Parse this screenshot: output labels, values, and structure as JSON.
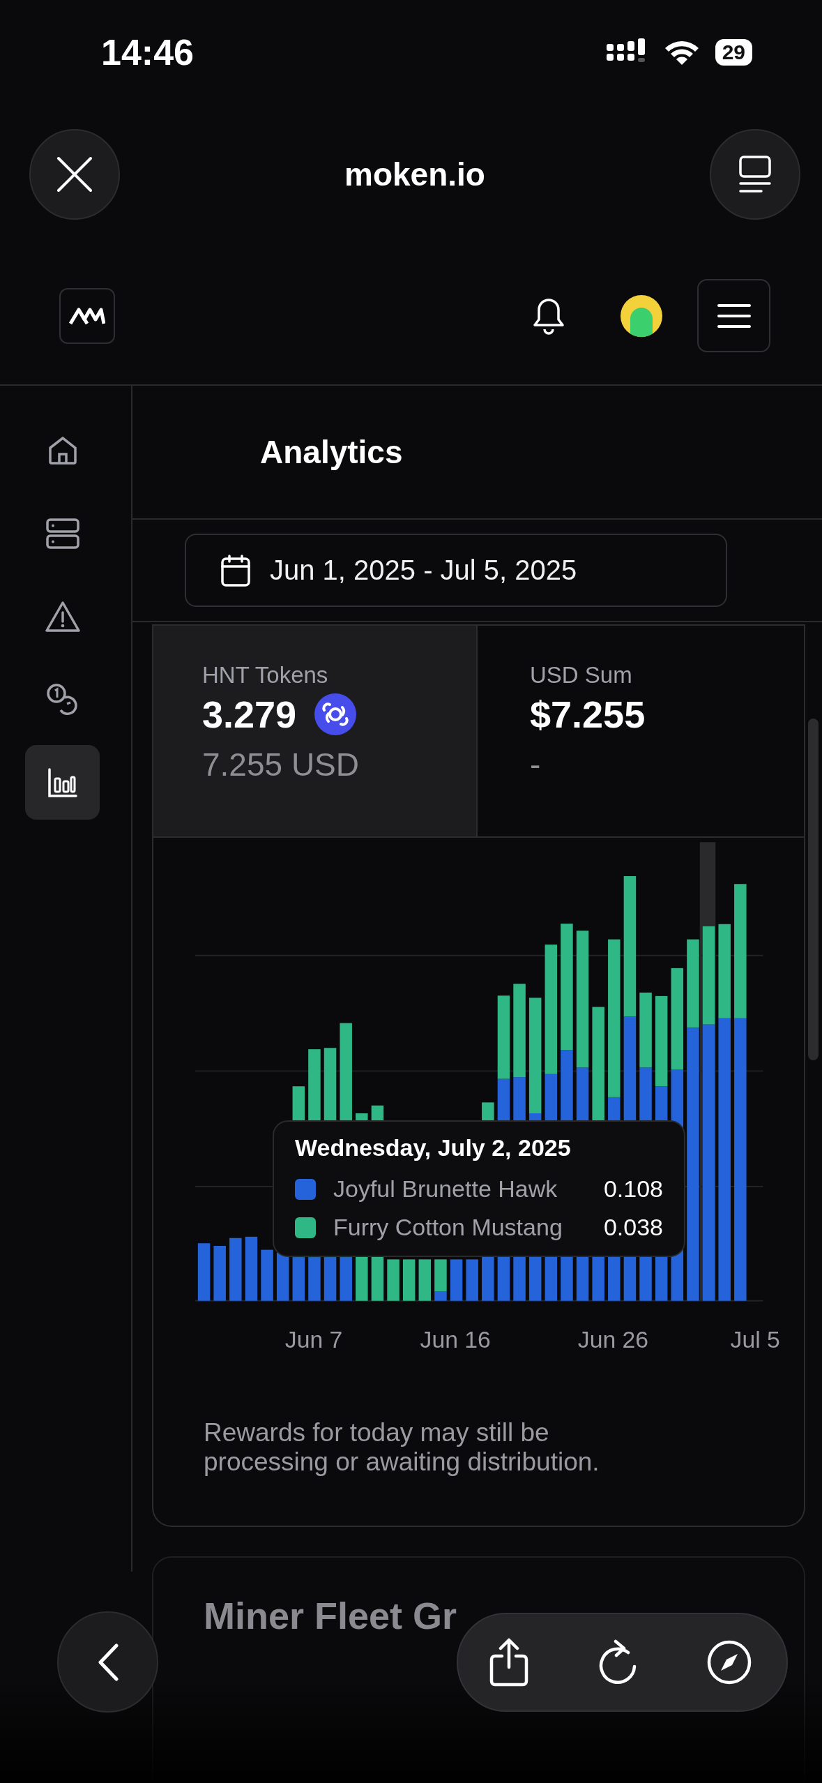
{
  "status_bar": {
    "time": "14:46",
    "battery": "29"
  },
  "browser": {
    "title": "moken.io"
  },
  "sidebar": {
    "items": [
      {
        "kind": "home",
        "selected": false
      },
      {
        "kind": "servers",
        "selected": false
      },
      {
        "kind": "alerts",
        "selected": false
      },
      {
        "kind": "coins",
        "selected": false
      },
      {
        "kind": "analytics",
        "selected": true
      }
    ]
  },
  "page": {
    "title": "Analytics"
  },
  "date_range": {
    "value": "Jun 1, 2025 - Jul 5, 2025"
  },
  "stats": [
    {
      "kind": "token",
      "label": "HNT Tokens",
      "value": "3.279",
      "sub": "7.255 USD",
      "selected": true
    },
    {
      "kind": "plain",
      "label": "USD Sum",
      "value": "$7.255",
      "sub": "-",
      "selected": false
    }
  ],
  "chart": {
    "x_labels": [
      "Jun 7",
      "Jun 16",
      "Jun 26",
      "Jul 5"
    ],
    "tooltip": {
      "title": "Wednesday, July 2, 2025",
      "series": [
        {
          "name": "Joyful Brunette Hawk",
          "value": "0.108",
          "color": "#2563db"
        },
        {
          "name": "Furry Cotton Mustang",
          "value": "0.038",
          "color": "#2fb886"
        }
      ]
    }
  },
  "note": "Rewards for today may still be processing or awaiting distribution.",
  "next_card": {
    "title": "Miner Fleet Gr"
  }
}
